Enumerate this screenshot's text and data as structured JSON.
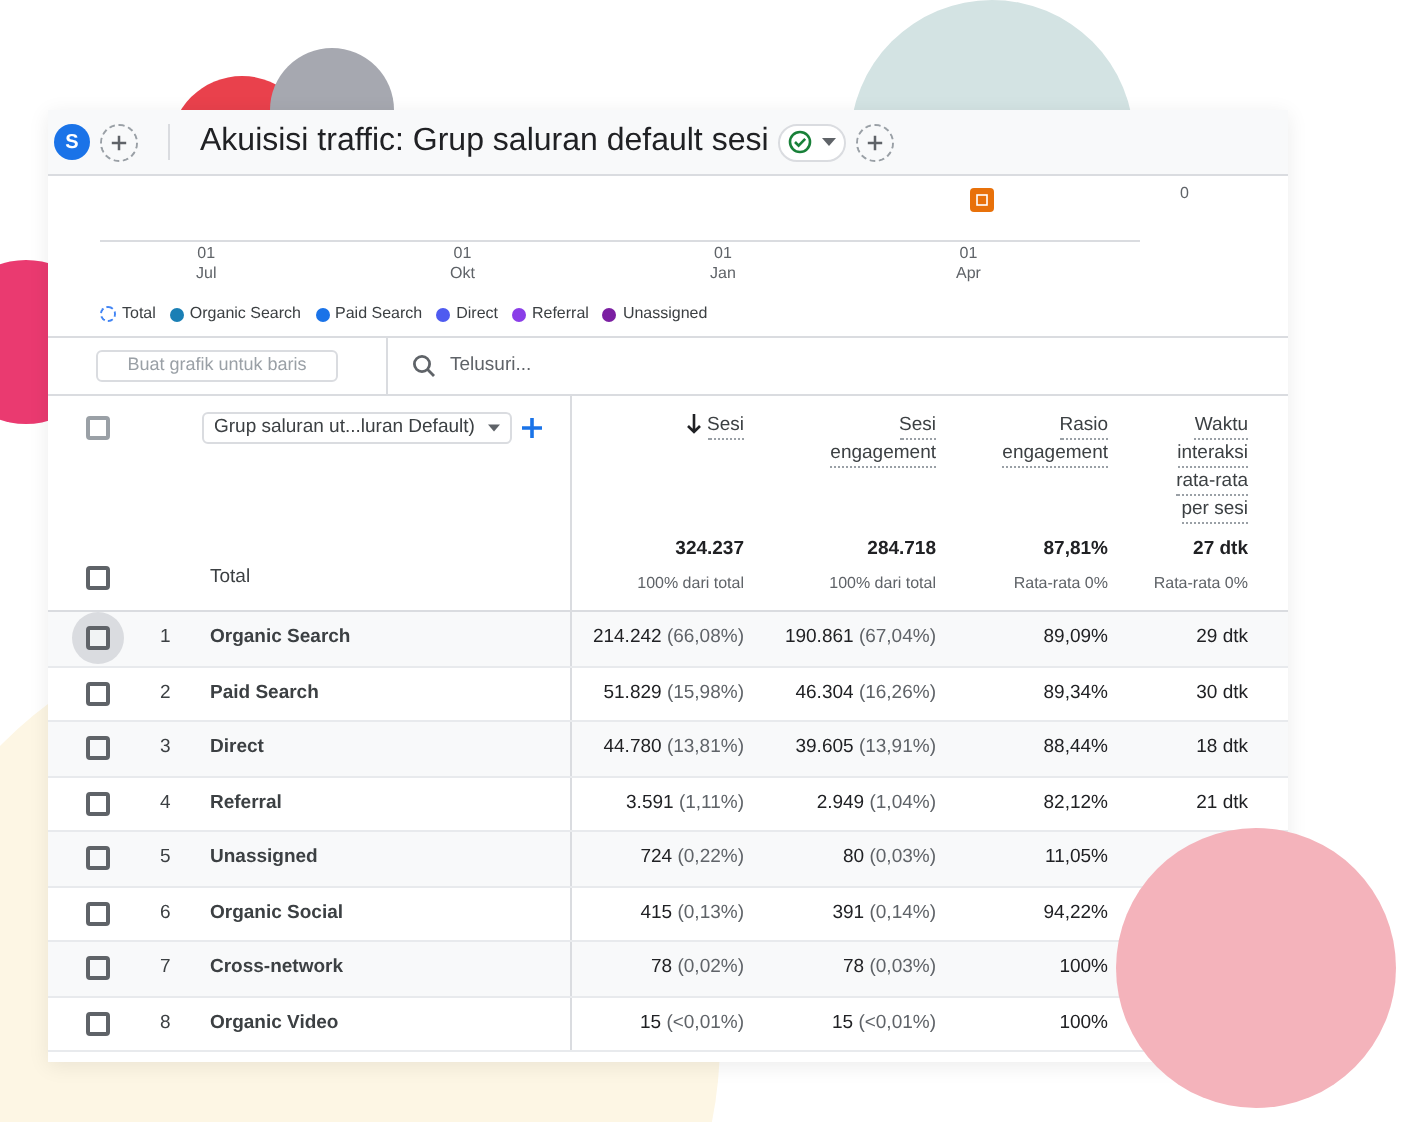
{
  "header": {
    "avatar": "S",
    "title": "Akuisisi traffic: Grup saluran default sesi",
    "status_ok": true
  },
  "chart": {
    "y_label": "0",
    "x_labels": [
      {
        "day": "01",
        "month": "Jul"
      },
      {
        "day": "01",
        "month": "Okt"
      },
      {
        "day": "01",
        "month": "Jan"
      },
      {
        "day": "01",
        "month": "Apr"
      }
    ],
    "legend": [
      {
        "label": "Total",
        "kind": "total",
        "color": "#4285f4"
      },
      {
        "label": "Organic Search",
        "kind": "dot",
        "color": "#1a7fb5"
      },
      {
        "label": "Paid Search",
        "kind": "dot",
        "color": "#1a73e8"
      },
      {
        "label": "Direct",
        "kind": "dot",
        "color": "#4f5bf0"
      },
      {
        "label": "Referral",
        "kind": "dot",
        "color": "#8a3ee8"
      },
      {
        "label": "Unassigned",
        "kind": "dot",
        "color": "#7b1fa2"
      }
    ]
  },
  "toolbar": {
    "chart_button": "Buat grafik untuk baris",
    "search_placeholder": "Telusuri..."
  },
  "table": {
    "select_all_checked": false,
    "dimension": "Grup saluran ut...luran Default)",
    "columns": [
      {
        "lines": [
          "Sesi"
        ],
        "sorted": true
      },
      {
        "lines": [
          "Sesi",
          "engagement"
        ],
        "sorted": false
      },
      {
        "lines": [
          "Rasio",
          "engagement"
        ],
        "sorted": false
      },
      {
        "lines": [
          "Waktu",
          "interaksi",
          "rata-rata",
          "per sesi"
        ],
        "sorted": false
      }
    ],
    "total": {
      "label": "Total",
      "checked": false,
      "cells": [
        {
          "value": "324.237",
          "note": "100% dari total"
        },
        {
          "value": "284.718",
          "note": "100% dari total"
        },
        {
          "value": "87,81%",
          "note": "Rata-rata 0%"
        },
        {
          "value": "27 dtk",
          "note": "Rata-rata 0%"
        }
      ]
    },
    "rows": [
      {
        "num": "1",
        "name": "Organic Search",
        "hovered": true,
        "checked": false,
        "cells": [
          {
            "value": "214.242",
            "pct": "(66,08%)"
          },
          {
            "value": "190.861",
            "pct": "(67,04%)"
          },
          {
            "value": "89,09%"
          },
          {
            "value": "29 dtk"
          }
        ]
      },
      {
        "num": "2",
        "name": "Paid Search",
        "hovered": false,
        "checked": false,
        "cells": [
          {
            "value": "51.829",
            "pct": "(15,98%)"
          },
          {
            "value": "46.304",
            "pct": "(16,26%)"
          },
          {
            "value": "89,34%"
          },
          {
            "value": "30 dtk"
          }
        ]
      },
      {
        "num": "3",
        "name": "Direct",
        "hovered": false,
        "checked": false,
        "cells": [
          {
            "value": "44.780",
            "pct": "(13,81%)"
          },
          {
            "value": "39.605",
            "pct": "(13,91%)"
          },
          {
            "value": "88,44%"
          },
          {
            "value": "18 dtk"
          }
        ]
      },
      {
        "num": "4",
        "name": "Referral",
        "hovered": false,
        "checked": false,
        "cells": [
          {
            "value": "3.591",
            "pct": "(1,11%)"
          },
          {
            "value": "2.949",
            "pct": "(1,04%)"
          },
          {
            "value": "82,12%"
          },
          {
            "value": "21 dtk"
          }
        ]
      },
      {
        "num": "5",
        "name": "Unassigned",
        "hovered": false,
        "checked": false,
        "cells": [
          {
            "value": "724",
            "pct": "(0,22%)"
          },
          {
            "value": "80",
            "pct": "(0,03%)"
          },
          {
            "value": "11,05%"
          }
        ]
      },
      {
        "num": "6",
        "name": "Organic Social",
        "hovered": false,
        "checked": false,
        "cells": [
          {
            "value": "415",
            "pct": "(0,13%)"
          },
          {
            "value": "391",
            "pct": "(0,14%)"
          },
          {
            "value": "94,22%"
          }
        ]
      },
      {
        "num": "7",
        "name": "Cross-network",
        "hovered": false,
        "checked": false,
        "cells": [
          {
            "value": "78",
            "pct": "(0,02%)"
          },
          {
            "value": "78",
            "pct": "(0,03%)"
          },
          {
            "value": "100%"
          }
        ]
      },
      {
        "num": "8",
        "name": "Organic Video",
        "hovered": false,
        "checked": false,
        "cells": [
          {
            "value": "15",
            "pct": "(<0,01%)"
          },
          {
            "value": "15",
            "pct": "(<0,01%)"
          },
          {
            "value": "100%"
          }
        ]
      }
    ]
  }
}
